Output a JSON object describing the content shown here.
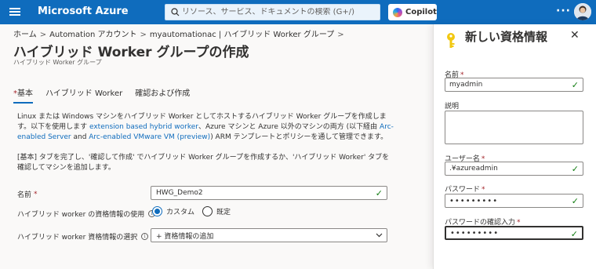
{
  "topbar": {
    "brand": "Microsoft Azure",
    "search_placeholder": "リソース、サービス、ドキュメントの検索 (G+/)",
    "copilot_label": "Copilot",
    "more": "···",
    "color": "#0f6cbd"
  },
  "breadcrumb": {
    "items": [
      "ホーム",
      "Automation アカウント",
      "myautomationac | ハイブリッド Worker グループ"
    ],
    "separator": ">"
  },
  "page": {
    "title": "ハイブリッド Worker グループの作成",
    "subtitle": "ハイブリッド Worker グループ"
  },
  "tabs": [
    {
      "label": "基本",
      "required_marker": "*",
      "active": true
    },
    {
      "label": "ハイブリッド Worker",
      "active": false
    },
    {
      "label": "確認および作成",
      "active": false
    }
  ],
  "description": {
    "part1": "Linux または Windows マシンをハイブリッド Worker としてホストするハイブリッド Worker グループを作成します。以下を使用します ",
    "link1": "extension based hybrid worker",
    "part2": "、Azure マシンと Azure 以外のマシンの両方 (以下経由 ",
    "link2": "Arc-enabled Server",
    "part3": " and ",
    "link3": "Arc-enabled VMware VM (preview)",
    "part4": ") ARM テンプレートとポリシーを通して管理できます。",
    "note": "[基本] タブを完了し、'確認して作成' でハイブリッド Worker グループを作成するか、'ハイブリッド Worker' タブを確認してマシンを追加します。"
  },
  "form": {
    "name_label": "名前",
    "name_required": "*",
    "name_value": "HWG_Demo2",
    "credentials_use_label": "ハイブリッド worker の資格情報の使用",
    "radio_custom": "カスタム",
    "radio_default": "既定",
    "radio_selected": "custom",
    "credentials_select_label": "ハイブリッド worker 資格情報の選択",
    "credentials_select_value": "+ 資格情報の追加"
  },
  "panel": {
    "title": "新しい資格情報",
    "name_label": "名前",
    "name_value": "myadmin",
    "description_label": "説明",
    "description_value": "",
    "username_label": "ユーザー名",
    "username_value": ".¥azureadmin",
    "password_label": "パスワード",
    "password_value": "•••••••••",
    "confirm_label": "パスワードの確認入力",
    "confirm_value": "•••••••••",
    "required_marker": "*"
  },
  "icons": {
    "key_color": "#f2c811",
    "check_color": "#107c10",
    "link_color": "#0f6cbd",
    "required_color": "#a4262c"
  }
}
